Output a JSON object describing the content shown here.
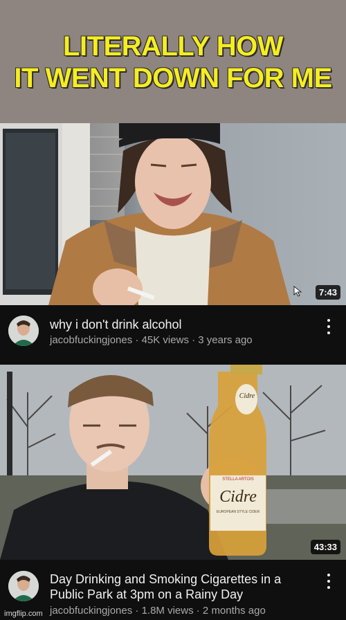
{
  "caption": {
    "text_line1": "LITERALLY HOW",
    "text_line2": "IT WENT DOWN FOR ME",
    "color": "#f5ed21"
  },
  "videos": [
    {
      "duration": "7:43",
      "title": "why i don't drink alcohol",
      "meta": "jacobfuckingjones · 45K views · 3 years ago"
    },
    {
      "duration": "43:33",
      "title_line1": "Day Drinking and Smoking Cigarettes in a",
      "title_line2": "Public Park at 3pm on a Rainy Day",
      "meta": "jacobfuckingjones · 1.8M views · 2 months ago",
      "bottle_label_top": "Cidre",
      "bottle_label_main": "Cidre",
      "bottle_label_sub": "EUROPEAN STYLE CIDER",
      "bottle_brand": "STELLA ARTOIS"
    }
  ],
  "watermark": "imgflip.com",
  "icons": [
    "kebab-menu-icon",
    "cursor-icon"
  ]
}
